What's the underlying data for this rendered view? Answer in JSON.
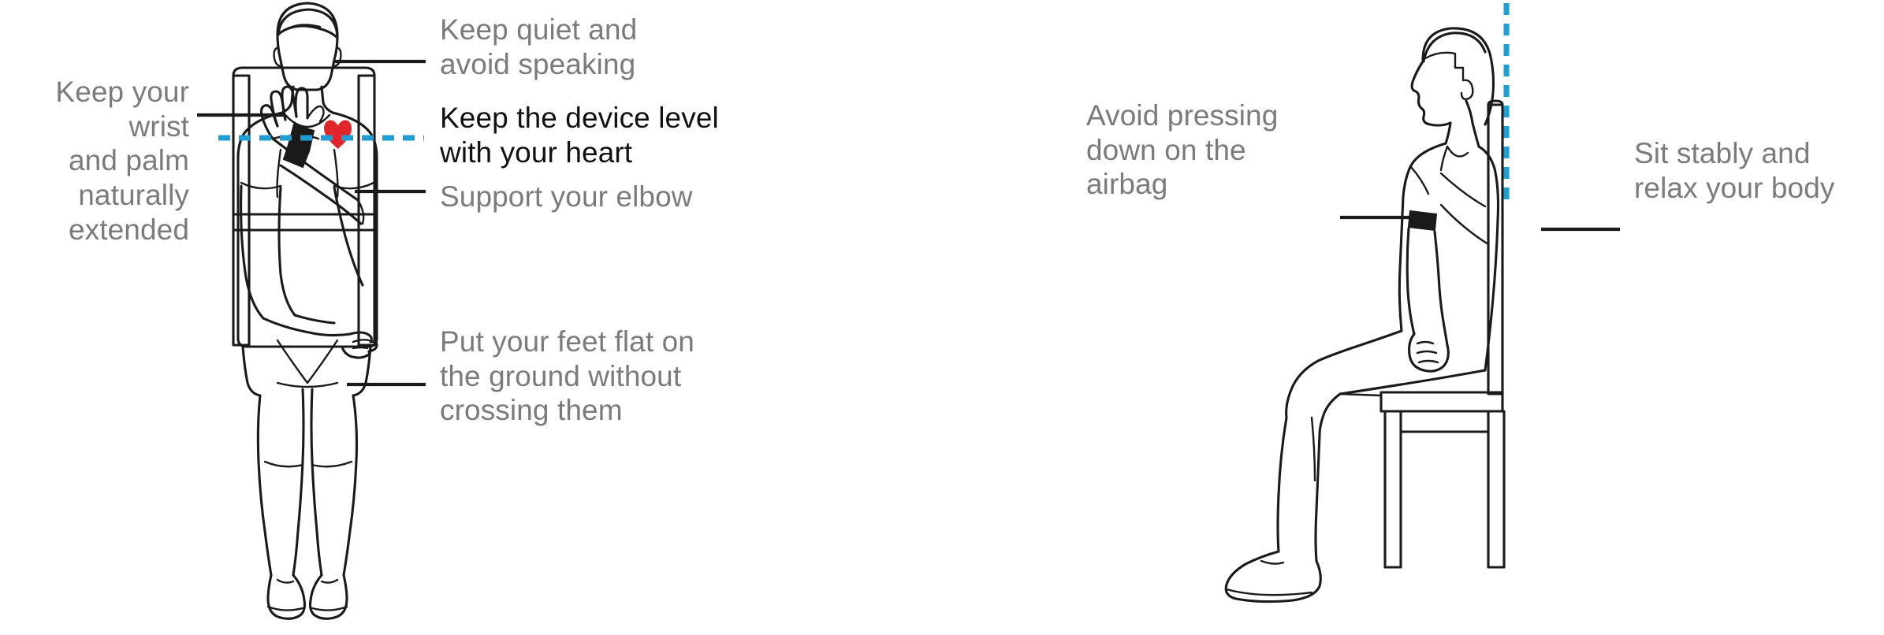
{
  "diagram": {
    "title": "Blood pressure measurement posture guide",
    "colors": {
      "dashed_line": "#1f9ed4",
      "heart": "#e0262b",
      "device": "#1a1a1a",
      "label_gray": "#7b7b7b",
      "label_emphasis": "#111111",
      "outline": "#1a1a1a",
      "background": "#ffffff"
    }
  },
  "figures": [
    {
      "id": "front-view",
      "name": "seated person front view with wrist blood pressure device"
    },
    {
      "id": "side-view",
      "name": "seated person side profile against chair back"
    }
  ],
  "labels": [
    {
      "id": "wrist-palm",
      "text": "Keep your wrist\nand palm naturally\nextended",
      "emphasis": false
    },
    {
      "id": "keep-quiet",
      "text": "Keep quiet and\navoid speaking",
      "emphasis": false
    },
    {
      "id": "device-level",
      "text": "Keep the device level\nwith your heart",
      "emphasis": true
    },
    {
      "id": "support-elbow",
      "text": "Support your elbow",
      "emphasis": false
    },
    {
      "id": "feet-flat",
      "text": "Put your feet flat on\nthe ground without\ncrossing them",
      "emphasis": false
    },
    {
      "id": "avoid-pressing",
      "text": "Avoid pressing\ndown on the\nairbag",
      "emphasis": false
    },
    {
      "id": "sit-stably",
      "text": "Sit stably and\nrelax your body",
      "emphasis": false
    }
  ],
  "icons": {
    "heart": "heart-icon",
    "wrist_device": "wrist-blood-pressure-device-icon",
    "heart_level_line": "heart-level-dashed-line",
    "posture_line": "vertical-posture-dashed-line"
  }
}
